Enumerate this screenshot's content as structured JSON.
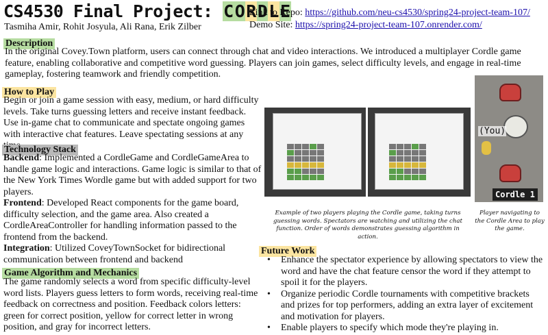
{
  "header": {
    "title_prefix": "CS4530 Final Project: ",
    "title_letters": [
      "C",
      "O",
      "R",
      "D",
      "L",
      "E"
    ],
    "title_letter_colors": [
      "#b6dca1",
      "#b6dca1",
      "#fce5a1",
      "#b6dca1",
      "#fce5a1",
      "#b6dca1"
    ],
    "authors": "Tasmiha Amir, Rohit Josyula, Ali Rana, Erik Zilber"
  },
  "links": {
    "repo_label": "Link to Repo: ",
    "repo_url": "https://github.com/neu-cs4530/spring24-project-team-107/",
    "demo_label": "Demo Site: ",
    "demo_url": "https://spring24-project-team-107.onrender.com/"
  },
  "description": {
    "heading": "Description",
    "text": "In the original Covey.Town platform, users can connect through chat and video interactions. We introduced a multiplayer Cordle game feature, enabling collaborative and competitive word guessing. Players can join games, select difficulty levels, and engage in real-time gameplay, fostering teamwork and friendly competition."
  },
  "how_to_play": {
    "heading": "How to Play",
    "text": "Begin or join a game session with easy, medium, or hard difficulty levels. Take turns guessing letters and receive instant feedback. Use in-game chat to communicate and spectate ongoing games with interactive chat features. Leave spectating sessions at any time."
  },
  "tech_stack": {
    "heading": "Technology Stack",
    "backend_label": "Backend",
    "backend_text": ": Implemented a CordleGame and CordleGameArea to handle game logic and interactions. Game logic is similar to that of the New York Times Wordle game but with added support for two players.",
    "frontend_label": "Frontend",
    "frontend_text": ": Developed React components for the game board, difficulty selection, and the game area. Also created a CordleAreaController for handling information passed to the frontend from the backend.",
    "integration_label": "Integration",
    "integration_text": ": Utilized CoveyTownSocket for bidirectional communication between frontend and backend"
  },
  "algorithm": {
    "heading": "Game Algorithm and Mechanics",
    "text": "The game randomly selects a word from specific difficulty-level word lists. Players guess letters to form words, receiving real-time feedback on correctness and position. Feedback colors letters: green for correct position, yellow for correct letter in wrong position, and gray for incorrect letters."
  },
  "figures": {
    "left_caption": "Example of two players playing the Cordle game, taking turns guessing words. Spectators are watching and utilizing the chat function. Order of words demonstrates guessing algorithm in action.",
    "right_caption": "Player navigating to the Cordle Area to play the game.",
    "you_label": "(You)",
    "sign_label": "Cordle 1"
  },
  "future_work": {
    "heading": "Future Work",
    "items": [
      "Enhance the spectator experience by allowing spectators to view the word and have the chat feature censor the word if they attempt to spoil it for the players.",
      "Organize periodic Cordle tournaments with competitive brackets and prizes for top performers, adding an extra layer of excitement and motivation for players.",
      "Enable players to specify which mode they're playing in."
    ]
  },
  "colors": {
    "green": "#b6dca1",
    "yellow": "#fce5a1",
    "gray": "#b9b9b9",
    "link": "#1a0dab"
  }
}
